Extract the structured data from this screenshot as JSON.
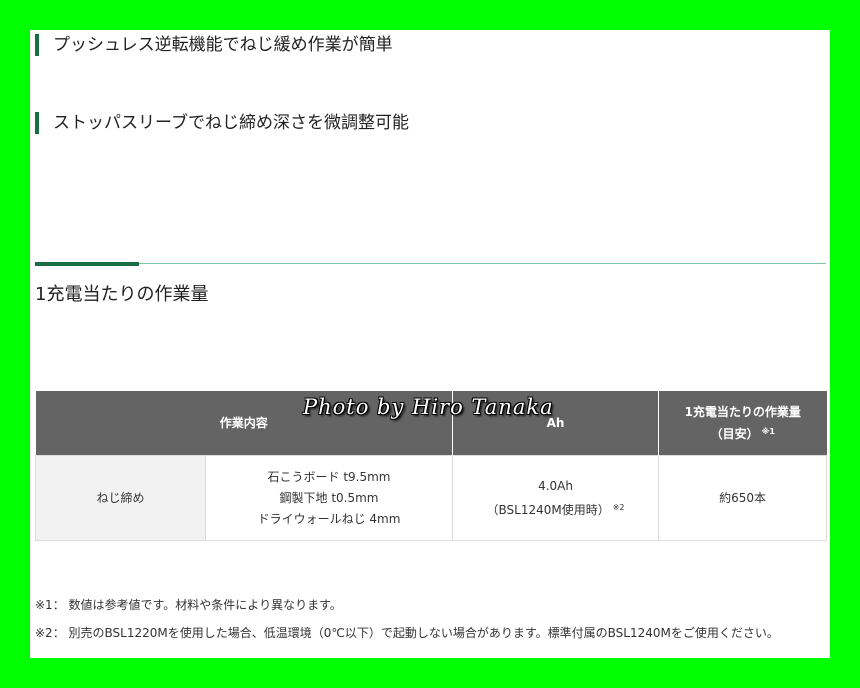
{
  "features": [
    "プッシュレス逆転機能でねじ緩め作業が簡単",
    "ストッパスリーブでねじ締め深さを微調整可能"
  ],
  "section": {
    "title": "1充電当たりの作業量"
  },
  "table": {
    "headers": {
      "work": "作業内容",
      "ah": "Ah",
      "amount": "1充電当たりの作業量",
      "amount_sub": "（目安）",
      "amount_mark": "※1"
    },
    "row": {
      "label": "ねじ締め",
      "material_lines": [
        "石こうボード t9.5mm",
        "鋼製下地 t0.5mm",
        "ドライウォールねじ 4mm"
      ],
      "ah_value": "4.0Ah",
      "ah_note": "（BSL1240M使用時）",
      "ah_mark": "※2",
      "amount_value": "約650本"
    }
  },
  "watermark": "Photo by Hiro Tanaka",
  "notes": [
    "※1： 数値は参考値です。材料や条件により異なります。",
    "※2： 別売のBSL1220Mを使用した場合、低温環境（0℃以下）で起動しない場合があります。標準付属のBSL1240Mをご使用ください。"
  ],
  "colors": {
    "accent": "#1a6e46",
    "header_bg": "#646464",
    "frame": "#00ff00"
  }
}
